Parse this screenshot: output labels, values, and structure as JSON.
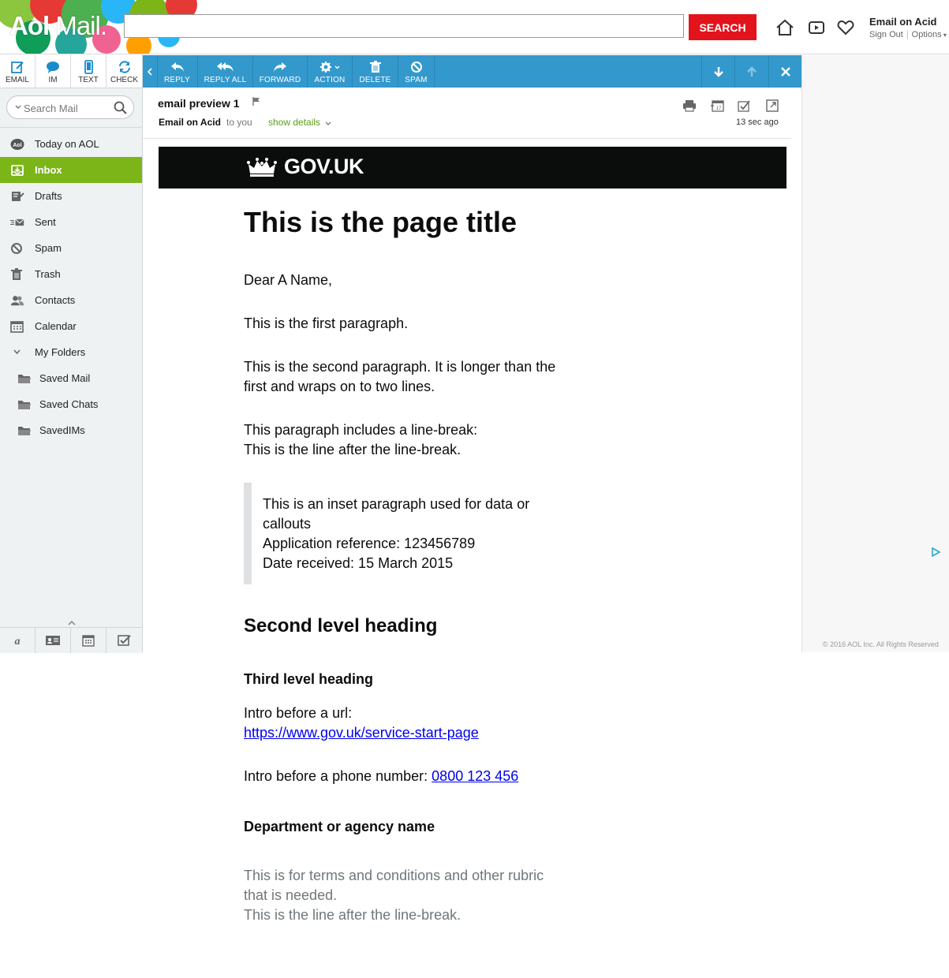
{
  "header": {
    "logo_aol": "Aol",
    "logo_mail": "Mail.",
    "search_value": "",
    "search_button": "SEARCH",
    "user_name": "Email on Acid",
    "sign_out": "Sign Out",
    "options": "Options",
    "icons": [
      "home-icon",
      "video-icon",
      "heart-icon"
    ]
  },
  "compose": {
    "email": "EMAIL",
    "im": "IM",
    "text": "TEXT",
    "check": "CHECK"
  },
  "sidebar": {
    "search_placeholder": "Search Mail",
    "items": [
      {
        "label": "Today on AOL",
        "icon": "aol-icon"
      },
      {
        "label": "Inbox",
        "icon": "inbox-icon",
        "active": true
      },
      {
        "label": "Drafts",
        "icon": "drafts-icon"
      },
      {
        "label": "Sent",
        "icon": "sent-icon"
      },
      {
        "label": "Spam",
        "icon": "spam-icon"
      },
      {
        "label": "Trash",
        "icon": "trash-icon"
      },
      {
        "label": "Contacts",
        "icon": "contacts-icon"
      },
      {
        "label": "Calendar",
        "icon": "calendar-icon"
      },
      {
        "label": "My Folders",
        "icon": "chevron-down-icon"
      },
      {
        "label": "Saved Mail",
        "icon": "folder-icon"
      },
      {
        "label": "Saved Chats",
        "icon": "folder-icon"
      },
      {
        "label": "SavedIMs",
        "icon": "folder-icon"
      }
    ],
    "bottom_icons": [
      "aim-icon",
      "contact-card-icon",
      "calendar-icon",
      "tasks-icon"
    ]
  },
  "toolbar": {
    "reply": "REPLY",
    "reply_all": "REPLY ALL",
    "forward": "FORWARD",
    "action": "ACTION",
    "delete": "DELETE",
    "spam": "SPAM"
  },
  "message": {
    "subject": "email preview 1",
    "sender": "Email on Acid",
    "to": "to you",
    "show_details": "show details",
    "time_ago": "13 sec ago"
  },
  "email_body": {
    "govuk_logo": "GOV.UK",
    "title": "This is the page title",
    "greeting": "Dear A Name,",
    "para1": "This is the first paragraph.",
    "para2_line1": "This is the second paragraph. It is longer than the",
    "para2_line2": "first and wraps on to two lines.",
    "para3_line1": "This paragraph includes a line-break:",
    "para3_line2": "This is the line after the line-break.",
    "inset_line1": "This is an inset paragraph used for data or",
    "inset_line2": "callouts",
    "inset_line3": "Application reference: 123456789",
    "inset_line4": "Date received: 15 March 2015",
    "h2": "Second level heading",
    "h3": "Third level heading",
    "url_intro": "Intro before a url:",
    "url": "https://www.gov.uk/service-start-page",
    "phone_intro": "Intro before a phone number: ",
    "phone": "0800 123 456",
    "dept": "Department or agency name",
    "rubric_line1": "This is for terms and conditions and other rubric",
    "rubric_line2": "that is needed.",
    "rubric_line3": "This is the line after the line-break."
  },
  "footer": {
    "copyright": "© 2016 AOL Inc. All Rights Reserved"
  },
  "colors": {
    "search_button": "#e3131b",
    "toolbar": "#3399cc",
    "inbox_active": "#7cb518",
    "show_details": "#5a9e1a",
    "govuk_bar": "#0b0c0c",
    "rubric": "#6f777b"
  }
}
